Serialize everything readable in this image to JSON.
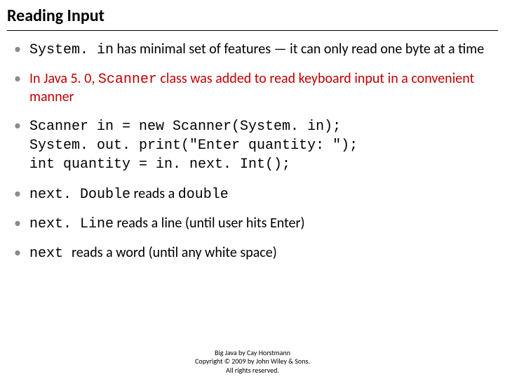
{
  "title": "Reading Input",
  "b1": {
    "code": "System. in",
    "rest": " has minimal set of features — it can only read one byte at a time"
  },
  "b2": {
    "pre": "In Java 5. 0, ",
    "code": "Scanner",
    "rest": " class was added to read keyboard input in a convenient manner"
  },
  "b3_code": "Scanner in = new Scanner(System. in);\nSystem. out. print(\"Enter quantity: \");\nint quantity = in. next. Int();",
  "b4": {
    "code1": "next. Double",
    "mid": " reads a ",
    "code2": "double"
  },
  "b5": {
    "code": "next. Line",
    "rest": " reads a line (until user hits Enter)"
  },
  "b6": {
    "code": "next ",
    "rest": " reads a word (until any white space)"
  },
  "footer": {
    "l1": "Big Java by Cay Horstmann",
    "l2": "Copyright © 2009 by John Wiley & Sons. ",
    "l3": "All rights reserved."
  }
}
